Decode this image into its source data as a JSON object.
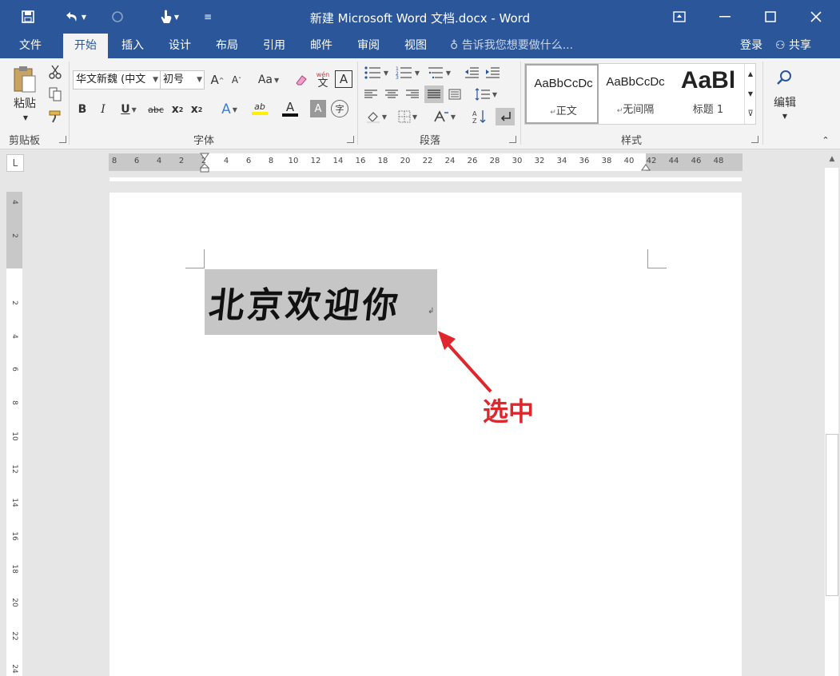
{
  "window": {
    "title": "新建 Microsoft Word 文档.docx - Word",
    "restore_label": "▣",
    "minimize_label": "—",
    "maximize_label": "☐",
    "close_label": "✕"
  },
  "quick_access": {
    "save_icon": "save-icon",
    "undo_icon": "undo-icon",
    "redo_icon": "redo-icon",
    "touch_icon": "touch-mode-icon",
    "customize_icon": "customize-icon"
  },
  "tabs": {
    "file": "文件",
    "home": "开始",
    "insert": "插入",
    "design": "设计",
    "layout": "布局",
    "references": "引用",
    "mailings": "邮件",
    "review": "审阅",
    "view": "视图"
  },
  "tell_me": "告诉我您想要做什么...",
  "account": {
    "login": "登录",
    "share": "共享"
  },
  "ribbon": {
    "clipboard": {
      "paste_label": "粘贴",
      "group_label": "剪贴板"
    },
    "font": {
      "font_name": "华文新魏 (中文",
      "font_size": "初号",
      "grow_label": "A",
      "shrink_label": "A",
      "case_label": "Aa",
      "phonetic_label": "文",
      "phonetic_top": "wén",
      "border_label": "A",
      "bold": "B",
      "italic": "I",
      "underline": "U",
      "strike": "abc",
      "subscript": "x",
      "subscript_mark": "2",
      "superscript": "x",
      "superscript_mark": "2",
      "effects": "A",
      "highlight": "ab",
      "color": "A",
      "shading": "A",
      "enclose": "字",
      "group_label": "字体"
    },
    "paragraph": {
      "group_label": "段落"
    },
    "styles": {
      "items": [
        {
          "sample": "AaBbCcDc",
          "name": "正文"
        },
        {
          "sample": "AaBbCcDc",
          "name": "无间隔"
        },
        {
          "sample": "AaBl",
          "name": "标题 1"
        }
      ],
      "group_label": "样式"
    },
    "editing": {
      "label": "编辑"
    }
  },
  "ruler": {
    "corner": "L",
    "horizontal_ticks": [
      "8",
      "6",
      "4",
      "2",
      "2",
      "4",
      "6",
      "8",
      "10",
      "12",
      "14",
      "16",
      "18",
      "20",
      "22",
      "24",
      "26",
      "28",
      "30",
      "32",
      "34",
      "36",
      "38",
      "40",
      "42",
      "44",
      "46",
      "48"
    ],
    "vertical_ticks": [
      "4",
      "2",
      "2",
      "4",
      "6",
      "8",
      "10",
      "12",
      "14",
      "16",
      "18",
      "20",
      "22",
      "24"
    ]
  },
  "document": {
    "selected_text": "北京欢迎你",
    "paragraph_mark": "↲"
  },
  "annotation": {
    "label": "选中",
    "color": "#e0262d"
  },
  "colors": {
    "accent": "#2b579a",
    "selection": "#c6c6c6"
  }
}
